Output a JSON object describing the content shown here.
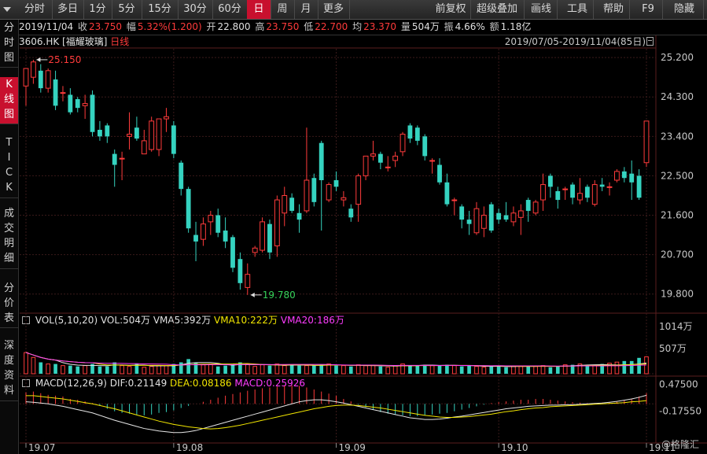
{
  "toolbar": {
    "left": [
      {
        "label": "分时",
        "x": 22,
        "w": 44
      },
      {
        "label": "多日",
        "x": 66,
        "w": 40
      },
      {
        "label": "1分",
        "x": 106,
        "w": 36
      },
      {
        "label": "5分",
        "x": 142,
        "w": 38
      },
      {
        "label": "15分",
        "x": 180,
        "w": 46
      },
      {
        "label": "30分",
        "x": 226,
        "w": 44
      },
      {
        "label": "60分",
        "x": 270,
        "w": 44
      },
      {
        "label": "日",
        "x": 314,
        "w": 30,
        "active": true
      },
      {
        "label": "周",
        "x": 344,
        "w": 30
      },
      {
        "label": "月",
        "x": 374,
        "w": 30
      },
      {
        "label": "更多",
        "x": 404,
        "w": 40
      }
    ],
    "right": [
      {
        "label": "前复权",
        "x": 548,
        "w": 50
      },
      {
        "label": "超级叠加",
        "x": 598,
        "w": 68
      },
      {
        "label": "画线",
        "x": 668,
        "w": 40
      },
      {
        "label": "工具",
        "x": 714,
        "w": 40
      },
      {
        "label": "帮助",
        "x": 760,
        "w": 40
      },
      {
        "label": "F9",
        "x": 806,
        "w": 36
      },
      {
        "label": "隐藏",
        "x": 846,
        "w": 48
      }
    ],
    "dropdown_icon": "caret-down-icon"
  },
  "sidebar": [
    {
      "label": "分时图",
      "y": 26,
      "h": 60
    },
    {
      "label": "K线图",
      "y": 98,
      "h": 60,
      "active": true
    },
    {
      "label": "TICK",
      "y": 172,
      "h": 80
    },
    {
      "label": "成交明细",
      "y": 262,
      "h": 80
    },
    {
      "label": "分价表",
      "y": 357,
      "h": 60
    },
    {
      "label": "深度资料",
      "y": 430,
      "h": 80
    }
  ],
  "info": {
    "date": "2019/11/04",
    "close_label": "收",
    "close": "23.750",
    "change_label": "幅",
    "change": "5.32%(1.200)",
    "open_label": "开",
    "open": "22.800",
    "high_label": "高",
    "high": "23.750",
    "low_label": "低",
    "low": "22.700",
    "avg_label": "均",
    "avg": "23.370",
    "volume_label": "量",
    "volume": "504万",
    "amplitude_label": "振",
    "amplitude": "4.66%",
    "amount_label": "额",
    "amount": "1.18亿"
  },
  "stock": {
    "code_name": "3606.HK [福耀玻璃]",
    "period": "日线"
  },
  "range": {
    "text": "2019/07/05-2019/11/04(85日)",
    "icon": "calendar-icon"
  },
  "volume_panel": {
    "title": "VOL(5,10,20) VOL:504万",
    "vma5": "VMA5:392万",
    "vma10": "VMA10:222万",
    "vma20": "VMA20:186万",
    "axis_ticks": [
      "1014万",
      "507万"
    ]
  },
  "macd_panel": {
    "title": "MACD(12,26,9)",
    "dif": "DIF:0.21149",
    "dea": "DEA:0.08186",
    "macd": "MACD:0.25926",
    "axis_ticks": [
      "0.47500",
      "-0.17550"
    ]
  },
  "watermark": "@格隆汇",
  "colors": {
    "up": "#ff3b3b",
    "down": "#35d3c0",
    "grid": "#3a1a1a",
    "ma_white": "#e6e6e6",
    "ma_yellow": "#f2e600",
    "ma_magenta": "#ff3cff"
  },
  "chart_data": {
    "type": "candlestick",
    "x_tick_labels": [
      "19.07",
      "19.08",
      "19.09",
      "19.10",
      "19.11"
    ],
    "x_tick_index": [
      0,
      20,
      42,
      64,
      84
    ],
    "y_tick_labels": [
      "25.200",
      "24.300",
      "23.400",
      "22.500",
      "21.600",
      "20.700",
      "19.800"
    ],
    "ylim": [
      19.4,
      25.4
    ],
    "annotations": [
      {
        "text": "25.150",
        "index": 1,
        "price": 25.15
      },
      {
        "text": "19.780",
        "index": 30,
        "price": 19.78
      }
    ],
    "candles": [
      {
        "o": 24.55,
        "h": 24.85,
        "l": 24.1,
        "c": 24.95
      },
      {
        "o": 24.75,
        "h": 25.15,
        "l": 24.6,
        "c": 25.1
      },
      {
        "o": 24.9,
        "h": 25.05,
        "l": 24.4,
        "c": 24.5
      },
      {
        "o": 24.5,
        "h": 24.95,
        "l": 24.4,
        "c": 24.9
      },
      {
        "o": 24.7,
        "h": 24.9,
        "l": 24.0,
        "c": 24.1
      },
      {
        "o": 24.4,
        "h": 24.55,
        "l": 24.2,
        "c": 24.4
      },
      {
        "o": 24.35,
        "h": 24.5,
        "l": 23.9,
        "c": 23.95
      },
      {
        "o": 24.25,
        "h": 24.3,
        "l": 23.95,
        "c": 24.05
      },
      {
        "o": 24.1,
        "h": 24.35,
        "l": 23.8,
        "c": 24.15
      },
      {
        "o": 24.35,
        "h": 24.45,
        "l": 23.4,
        "c": 23.5
      },
      {
        "o": 23.55,
        "h": 23.75,
        "l": 23.3,
        "c": 23.4
      },
      {
        "o": 23.65,
        "h": 23.7,
        "l": 23.25,
        "c": 23.4
      },
      {
        "o": 23.0,
        "h": 23.1,
        "l": 22.25,
        "c": 22.75
      },
      {
        "o": 22.9,
        "h": 23.05,
        "l": 22.4,
        "c": 22.9
      },
      {
        "o": 23.4,
        "h": 23.95,
        "l": 23.1,
        "c": 23.45
      },
      {
        "o": 23.6,
        "h": 23.85,
        "l": 23.3,
        "c": 23.35
      },
      {
        "o": 23.0,
        "h": 23.55,
        "l": 23.0,
        "c": 23.3
      },
      {
        "o": 23.1,
        "h": 23.85,
        "l": 23.05,
        "c": 23.75
      },
      {
        "o": 23.1,
        "h": 23.8,
        "l": 22.95,
        "c": 23.8
      },
      {
        "o": 23.8,
        "h": 24.05,
        "l": 23.5,
        "c": 23.85
      },
      {
        "o": 23.65,
        "h": 23.75,
        "l": 22.9,
        "c": 23.0
      },
      {
        "o": 22.8,
        "h": 22.85,
        "l": 22.05,
        "c": 22.2
      },
      {
        "o": 22.2,
        "h": 22.25,
        "l": 21.2,
        "c": 21.3
      },
      {
        "o": 21.15,
        "h": 21.45,
        "l": 20.55,
        "c": 21.0
      },
      {
        "o": 21.05,
        "h": 21.55,
        "l": 20.9,
        "c": 21.4
      },
      {
        "o": 21.45,
        "h": 21.7,
        "l": 21.15,
        "c": 21.6
      },
      {
        "o": 21.6,
        "h": 21.75,
        "l": 21.1,
        "c": 21.2
      },
      {
        "o": 21.25,
        "h": 21.55,
        "l": 20.85,
        "c": 21.0
      },
      {
        "o": 21.1,
        "h": 21.15,
        "l": 20.3,
        "c": 20.4
      },
      {
        "o": 20.6,
        "h": 20.75,
        "l": 19.9,
        "c": 20.05
      },
      {
        "o": 19.95,
        "h": 20.5,
        "l": 19.78,
        "c": 20.25
      },
      {
        "o": 20.75,
        "h": 20.9,
        "l": 20.65,
        "c": 20.85
      },
      {
        "o": 20.8,
        "h": 21.55,
        "l": 20.75,
        "c": 21.45
      },
      {
        "o": 21.4,
        "h": 21.5,
        "l": 20.6,
        "c": 20.75
      },
      {
        "o": 20.9,
        "h": 22.05,
        "l": 20.65,
        "c": 21.95
      },
      {
        "o": 21.65,
        "h": 22.25,
        "l": 21.35,
        "c": 22.05
      },
      {
        "o": 22.0,
        "h": 22.1,
        "l": 21.65,
        "c": 21.7
      },
      {
        "o": 21.65,
        "h": 21.85,
        "l": 21.2,
        "c": 21.5
      },
      {
        "o": 21.7,
        "h": 23.6,
        "l": 21.65,
        "c": 22.4
      },
      {
        "o": 22.45,
        "h": 22.55,
        "l": 21.8,
        "c": 21.9
      },
      {
        "o": 23.25,
        "h": 23.3,
        "l": 21.25,
        "c": 22.4
      },
      {
        "o": 21.95,
        "h": 22.35,
        "l": 21.9,
        "c": 22.3
      },
      {
        "o": 22.4,
        "h": 22.6,
        "l": 22.15,
        "c": 22.25
      },
      {
        "o": 21.95,
        "h": 22.15,
        "l": 21.8,
        "c": 22.0
      },
      {
        "o": 21.75,
        "h": 21.85,
        "l": 21.45,
        "c": 21.55
      },
      {
        "o": 21.85,
        "h": 22.55,
        "l": 21.45,
        "c": 22.5
      },
      {
        "o": 22.5,
        "h": 22.95,
        "l": 22.4,
        "c": 22.95
      },
      {
        "o": 22.95,
        "h": 23.3,
        "l": 22.85,
        "c": 23.0
      },
      {
        "o": 23.0,
        "h": 23.05,
        "l": 22.65,
        "c": 22.8
      },
      {
        "o": 22.7,
        "h": 22.95,
        "l": 22.6,
        "c": 22.7
      },
      {
        "o": 22.85,
        "h": 23.05,
        "l": 22.7,
        "c": 22.95
      },
      {
        "o": 23.05,
        "h": 23.5,
        "l": 22.95,
        "c": 23.45
      },
      {
        "o": 23.65,
        "h": 23.7,
        "l": 23.25,
        "c": 23.35
      },
      {
        "o": 23.6,
        "h": 23.65,
        "l": 23.2,
        "c": 23.3
      },
      {
        "o": 23.4,
        "h": 23.45,
        "l": 22.85,
        "c": 22.95
      },
      {
        "o": 22.85,
        "h": 22.9,
        "l": 22.55,
        "c": 22.85
      },
      {
        "o": 22.75,
        "h": 22.9,
        "l": 22.3,
        "c": 22.35
      },
      {
        "o": 22.35,
        "h": 22.55,
        "l": 21.8,
        "c": 21.85
      },
      {
        "o": 21.95,
        "h": 22.0,
        "l": 21.6,
        "c": 21.95
      },
      {
        "o": 21.8,
        "h": 21.85,
        "l": 21.3,
        "c": 21.5
      },
      {
        "o": 21.5,
        "h": 21.7,
        "l": 21.15,
        "c": 21.4
      },
      {
        "o": 21.2,
        "h": 21.9,
        "l": 21.15,
        "c": 21.75
      },
      {
        "o": 21.3,
        "h": 21.8,
        "l": 21.1,
        "c": 21.6
      },
      {
        "o": 21.85,
        "h": 21.9,
        "l": 21.2,
        "c": 21.25
      },
      {
        "o": 21.65,
        "h": 21.75,
        "l": 21.4,
        "c": 21.5
      },
      {
        "o": 21.6,
        "h": 21.9,
        "l": 21.45,
        "c": 21.5
      },
      {
        "o": 21.45,
        "h": 21.8,
        "l": 21.35,
        "c": 21.65
      },
      {
        "o": 21.55,
        "h": 21.85,
        "l": 21.15,
        "c": 21.7
      },
      {
        "o": 21.95,
        "h": 22.0,
        "l": 21.45,
        "c": 21.7
      },
      {
        "o": 21.65,
        "h": 21.95,
        "l": 21.6,
        "c": 21.9
      },
      {
        "o": 21.95,
        "h": 22.55,
        "l": 21.7,
        "c": 22.3
      },
      {
        "o": 22.5,
        "h": 22.55,
        "l": 22.0,
        "c": 22.25
      },
      {
        "o": 22.15,
        "h": 22.25,
        "l": 21.75,
        "c": 21.95
      },
      {
        "o": 22.2,
        "h": 22.25,
        "l": 21.95,
        "c": 22.2
      },
      {
        "o": 22.3,
        "h": 22.35,
        "l": 21.85,
        "c": 22.0
      },
      {
        "o": 21.95,
        "h": 22.45,
        "l": 21.85,
        "c": 22.1
      },
      {
        "o": 22.25,
        "h": 22.3,
        "l": 21.9,
        "c": 22.0
      },
      {
        "o": 21.85,
        "h": 22.4,
        "l": 21.8,
        "c": 22.3
      },
      {
        "o": 22.3,
        "h": 22.45,
        "l": 22.15,
        "c": 22.25
      },
      {
        "o": 22.25,
        "h": 22.35,
        "l": 22.05,
        "c": 22.25
      },
      {
        "o": 22.4,
        "h": 22.65,
        "l": 22.35,
        "c": 22.6
      },
      {
        "o": 22.6,
        "h": 22.7,
        "l": 22.35,
        "c": 22.45
      },
      {
        "o": 22.55,
        "h": 22.85,
        "l": 21.95,
        "c": 22.35
      },
      {
        "o": 22.5,
        "h": 22.65,
        "l": 21.95,
        "c": 22.0
      },
      {
        "o": 22.8,
        "h": 23.75,
        "l": 22.7,
        "c": 23.75
      }
    ],
    "volume": [
      1.3,
      1.0,
      0.7,
      0.6,
      0.6,
      0.5,
      0.5,
      0.45,
      0.5,
      0.6,
      0.45,
      0.45,
      0.7,
      0.5,
      0.45,
      0.6,
      0.4,
      0.45,
      0.5,
      0.5,
      0.6,
      0.7,
      0.9,
      0.7,
      0.55,
      0.6,
      0.45,
      0.5,
      0.55,
      0.7,
      0.6,
      0.45,
      0.55,
      0.5,
      0.6,
      0.5,
      0.55,
      0.5,
      0.5,
      0.5,
      0.55,
      0.6,
      0.5,
      0.5,
      0.45,
      0.55,
      0.5,
      0.5,
      0.45,
      0.4,
      0.5,
      0.6,
      0.5,
      0.5,
      0.55,
      0.5,
      0.5,
      0.55,
      0.5,
      0.45,
      0.5,
      0.45,
      0.4,
      0.45,
      0.5,
      0.4,
      0.45,
      0.45,
      0.5,
      0.45,
      0.5,
      0.4,
      0.45,
      0.55,
      0.55,
      0.6,
      0.55,
      0.5,
      0.6,
      0.5,
      0.55,
      0.6,
      0.6,
      0.75,
      0.8,
      0.6,
      0.65,
      0.55,
      0.6,
      0.5,
      2.4,
      1.0,
      1.2,
      2.0,
      2.6,
      1.6
    ],
    "macd_hist": [
      0.28,
      0.3,
      0.26,
      0.22,
      0.2,
      0.18,
      0.12,
      0.1,
      0.06,
      0.02,
      -0.05,
      -0.12,
      -0.18,
      -0.22,
      -0.24,
      -0.26,
      -0.28,
      -0.26,
      -0.22,
      -0.2,
      -0.16,
      -0.1,
      -0.05,
      0.0,
      0.05,
      0.1,
      0.15,
      0.2,
      0.24,
      0.28,
      0.32,
      0.35,
      0.38,
      0.4,
      0.42,
      0.44,
      0.45,
      0.44,
      0.4,
      0.35,
      0.3,
      0.25,
      0.2,
      0.12,
      0.06,
      -0.02,
      -0.08,
      -0.14,
      -0.2,
      -0.24,
      -0.26,
      -0.28,
      -0.3,
      -0.3,
      -0.28,
      -0.26,
      -0.24,
      -0.22,
      -0.18,
      -0.14,
      -0.1,
      -0.06,
      -0.02,
      0.02,
      0.04,
      0.06,
      0.08,
      0.1,
      0.1,
      0.12,
      0.12,
      0.1,
      0.08,
      0.06,
      0.04,
      0.03,
      0.02,
      0.02,
      0.03,
      0.04,
      0.05,
      0.08,
      0.12,
      0.18,
      0.26
    ],
    "dif": [
      0.05,
      0.04,
      0.02,
      0.0,
      -0.03,
      -0.06,
      -0.1,
      -0.14,
      -0.18,
      -0.22,
      -0.28,
      -0.34,
      -0.4,
      -0.45,
      -0.5,
      -0.55,
      -0.6,
      -0.63,
      -0.66,
      -0.68,
      -0.7,
      -0.7,
      -0.68,
      -0.65,
      -0.6,
      -0.55,
      -0.5,
      -0.45,
      -0.4,
      -0.35,
      -0.3,
      -0.25,
      -0.2,
      -0.15,
      -0.1,
      -0.05,
      0.0,
      0.05,
      0.08,
      0.1,
      0.1,
      0.08,
      0.05,
      0.02,
      -0.02,
      -0.06,
      -0.1,
      -0.14,
      -0.18,
      -0.22,
      -0.26,
      -0.3,
      -0.34,
      -0.36,
      -0.38,
      -0.38,
      -0.37,
      -0.35,
      -0.32,
      -0.3,
      -0.27,
      -0.24,
      -0.21,
      -0.18,
      -0.15,
      -0.12,
      -0.1,
      -0.08,
      -0.06,
      -0.05,
      -0.04,
      -0.03,
      -0.03,
      -0.02,
      -0.02,
      -0.01,
      0.0,
      0.01,
      0.02,
      0.04,
      0.06,
      0.09,
      0.12,
      0.16,
      0.21
    ],
    "dea": [
      0.2,
      0.2,
      0.18,
      0.16,
      0.14,
      0.12,
      0.09,
      0.06,
      0.03,
      0.0,
      -0.04,
      -0.08,
      -0.12,
      -0.17,
      -0.22,
      -0.27,
      -0.32,
      -0.37,
      -0.42,
      -0.46,
      -0.5,
      -0.53,
      -0.56,
      -0.58,
      -0.6,
      -0.61,
      -0.6,
      -0.58,
      -0.55,
      -0.52,
      -0.48,
      -0.44,
      -0.4,
      -0.36,
      -0.32,
      -0.28,
      -0.24,
      -0.2,
      -0.16,
      -0.12,
      -0.09,
      -0.06,
      -0.04,
      -0.03,
      -0.03,
      -0.04,
      -0.06,
      -0.08,
      -0.1,
      -0.13,
      -0.16,
      -0.19,
      -0.22,
      -0.25,
      -0.28,
      -0.3,
      -0.32,
      -0.33,
      -0.33,
      -0.32,
      -0.31,
      -0.29,
      -0.27,
      -0.25,
      -0.22,
      -0.19,
      -0.17,
      -0.14,
      -0.12,
      -0.1,
      -0.09,
      -0.07,
      -0.06,
      -0.05,
      -0.04,
      -0.03,
      -0.02,
      -0.01,
      0.0,
      0.01,
      0.02,
      0.03,
      0.05,
      0.06,
      0.08
    ]
  }
}
